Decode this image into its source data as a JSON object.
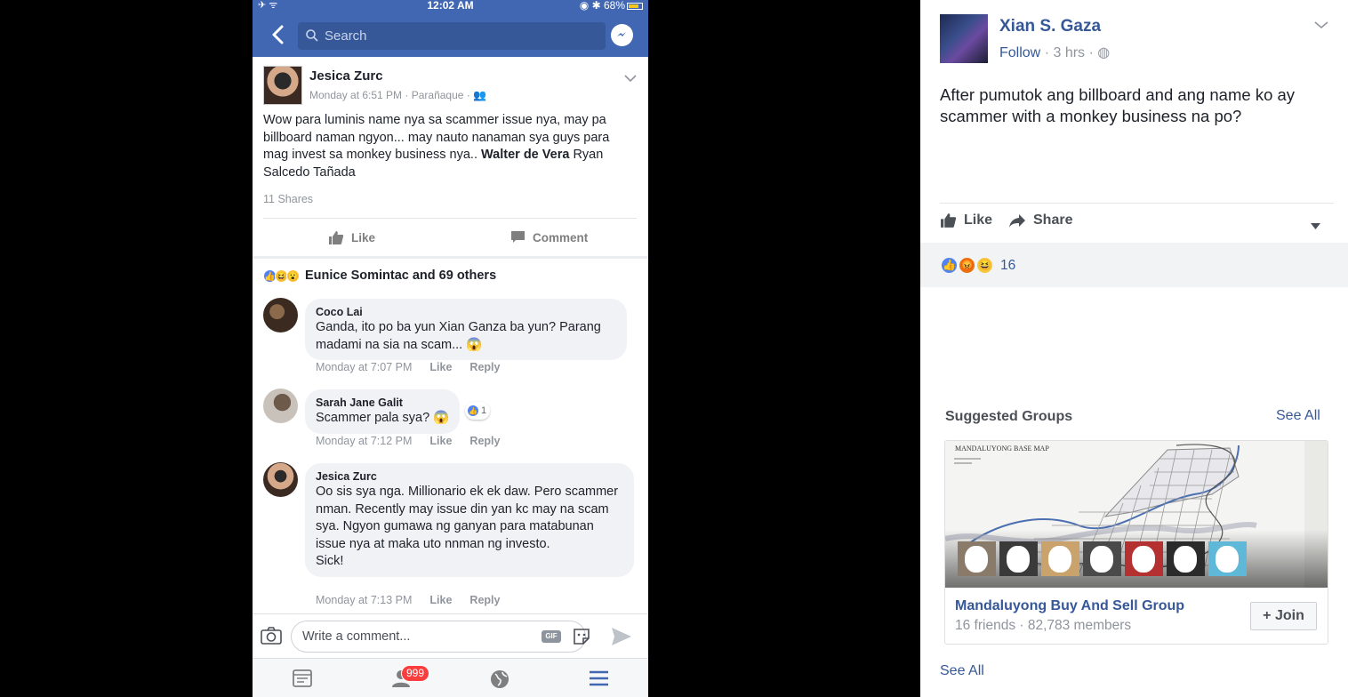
{
  "colors": {
    "fb_blue": "#4267b2",
    "link": "#365899",
    "text": "#1d2129",
    "muted": "#90949c",
    "bubble": "#f1f2f6",
    "badge_red": "#fa3e3e"
  },
  "phone": {
    "status": {
      "left": "✈ ᯤ",
      "time": "12:02 AM",
      "battery_pct": "68%",
      "battery_level": 0.68
    },
    "nav": {
      "search_placeholder": "Search"
    },
    "post": {
      "author": "Jesica Zurc",
      "meta": "Monday at 6:51 PM · Parañaque · ",
      "text_a": "Wow para luminis name nya sa scammer issue nya, may pa billboard naman ngyon... may nauto nanaman sya guys para mag invest sa monkey business nya.. ",
      "mention_bold": "Walter de Vera",
      "text_b": " Ryan Salcedo Tañada",
      "shares": "11 Shares",
      "like_label": "Like",
      "comment_label": "Comment",
      "reactions_summary": "Eunice Somintac and 69 others"
    },
    "comments": [
      {
        "name": "Coco Lai",
        "text": "Ganda, ito po ba yun Xian Ganza ba yun? Parang madami na sia na scam... 😱",
        "time": "Monday at 7:07 PM",
        "like": "Like",
        "reply": "Reply"
      },
      {
        "name": "Sarah Jane Galit",
        "text": "Scammer pala sya? 😱",
        "time": "Monday at 7:12 PM",
        "like": "Like",
        "reply": "Reply",
        "like_count": "1"
      },
      {
        "name": "Jesica Zurc",
        "text": "Oo sis sya nga. Millionario ek ek daw. Pero scammer nman. Recently may issue din yan kc may na scam sya. Ngyon gumawa ng ganyan para matabunan issue nya at maka uto nnman ng investo.",
        "text2": "Sick!",
        "time": "Monday at 7:13 PM",
        "like": "Like",
        "reply": "Reply"
      }
    ],
    "composer": {
      "placeholder": "Write a comment...",
      "gif": "GIF"
    },
    "tabbar": {
      "friends_badge": "999"
    }
  },
  "desktop": {
    "author": "Xian S. Gaza",
    "follow": "Follow",
    "time": "3 hrs",
    "post_text": "After pumutok ang billboard and ang name ko ay scammer with a monkey business na po?",
    "like_label": "Like",
    "share_label": "Share",
    "reaction_count": "16",
    "suggested": {
      "title": "Suggested Groups",
      "see_all": "See All",
      "map_title": "MANDALUYONG BASE MAP",
      "group_name": "Mandaluyong Buy And Sell Group",
      "group_info": "16 friends · 82,783 members",
      "join_label": "Join",
      "footer_see_all": "See All"
    }
  }
}
